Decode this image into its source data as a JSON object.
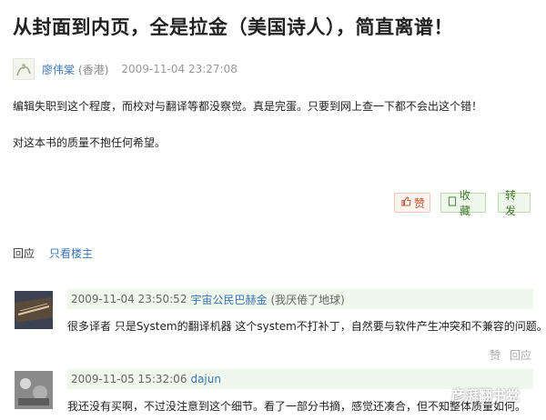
{
  "post": {
    "title": "从封面到内页，全是拉金（美国诗人），简直离谱！",
    "author": "廖伟棠",
    "location": "(香港)",
    "time": "2009-11-04 23:27:08",
    "body": [
      "编辑失职到这个程度，而校对与翻译等都没察觉。真是完蛋。只要到网上查一下都不会出这个错！",
      "对这本书的质量不抱任何希望。"
    ]
  },
  "actions": {
    "like": "赞",
    "favorite": "收藏",
    "share": "转发"
  },
  "tabs": {
    "reply": "回应",
    "owner_only": "只看楼主"
  },
  "comments": [
    {
      "time": "2009-11-04 23:50:52",
      "user": "宇宙公民巴赫金",
      "signature": "(我厌倦了地球)",
      "text": "很多译者 只是System的翻译机器 这个system不打补丁，自然要与软件产生冲突和不兼容的问题。",
      "like": "赞",
      "reply": "回应"
    },
    {
      "time": "2009-11-05 15:32:06",
      "user": "dajun",
      "text": "我还没有买啊，不过没注意到这个细节。看了一部分书摘，感觉还凑合，但不知整体质量如何。"
    }
  ],
  "watermark": "彦湃翻书党",
  "colors": {
    "link": "#3a76b6",
    "comment_header_bg": "#f0f7ec",
    "like_accent": "#c04e2a",
    "fav_accent": "#3d7a2a"
  }
}
